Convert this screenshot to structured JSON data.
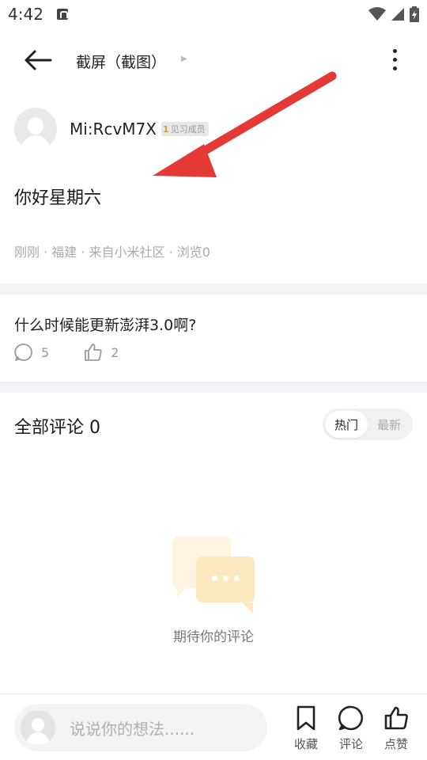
{
  "status_bar": {
    "time": "4:42",
    "icons": [
      "a-notification-icon",
      "wifi-icon",
      "cell-signal-icon",
      "battery-icon"
    ]
  },
  "header": {
    "title": "截屏（截图）",
    "back_icon": "arrow-left-icon",
    "more_icon": "more-vertical-icon"
  },
  "post": {
    "author": "Mi:RcvM7X",
    "badge": {
      "level": "1",
      "label": "见习成员"
    },
    "content": "你好星期六",
    "meta": "刚刚 · 福建 · 来自小米社区 · 浏览0"
  },
  "related": {
    "title": "什么时候能更新澎湃3.0啊?",
    "comment_count": "5",
    "like_count": "2"
  },
  "comments": {
    "header": "全部评论 0",
    "sort_options": [
      "热门",
      "最新"
    ],
    "active_sort": "热门",
    "empty_text": "期待你的评论"
  },
  "bottom_bar": {
    "placeholder": "说说你的想法......",
    "actions": [
      {
        "label": "收藏",
        "icon": "bookmark-icon"
      },
      {
        "label": "评论",
        "icon": "comment-icon"
      },
      {
        "label": "点赞",
        "icon": "thumbs-up-icon"
      }
    ]
  },
  "colors": {
    "annotation_arrow": "#e53935",
    "badge_gold": "#c9a23a",
    "divider": "#f2f3f7"
  }
}
